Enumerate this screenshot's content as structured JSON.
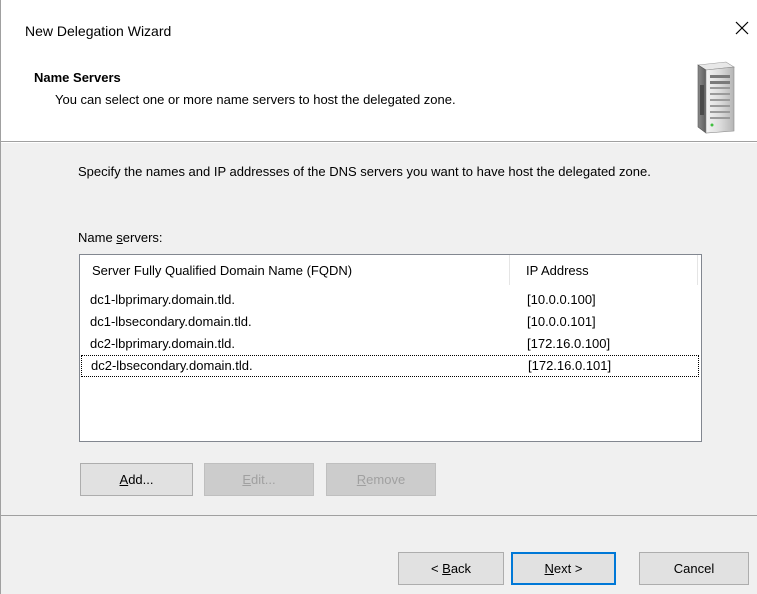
{
  "window": {
    "title": "New Delegation Wizard",
    "close_glyph": "✕"
  },
  "header": {
    "title": "Name Servers",
    "subtitle": "You can select one or more name servers to host the delegated zone.",
    "icon": "server-icon"
  },
  "body": {
    "instruction": "Specify the names and IP addresses of the DNS servers you want to have host the delegated zone.",
    "ns_label_prefix": "Name ",
    "ns_label_accel": "s",
    "ns_label_suffix": "ervers:"
  },
  "list": {
    "columns": [
      "Server Fully Qualified Domain Name (FQDN)",
      "IP Address"
    ],
    "rows": [
      {
        "fqdn": "dc1-lbprimary.domain.tld.",
        "ip": "[10.0.0.100]"
      },
      {
        "fqdn": "dc1-lbsecondary.domain.tld.",
        "ip": "[10.0.0.101]"
      },
      {
        "fqdn": "dc2-lbprimary.domain.tld.",
        "ip": "[172.16.0.100]"
      },
      {
        "fqdn": "dc2-lbsecondary.domain.tld.",
        "ip": "[172.16.0.101]"
      }
    ]
  },
  "buttons": {
    "add_accel": "A",
    "add_rest": "dd...",
    "edit_accel": "E",
    "edit_rest": "dit...",
    "remove_accel": "R",
    "remove_rest": "emove",
    "back_prefix": "< ",
    "back_accel": "B",
    "back_rest": "ack",
    "next_accel": "N",
    "next_rest": "ext >",
    "cancel": "Cancel"
  },
  "colors": {
    "accent": "#0078d7",
    "dialog_bg": "#f0f0f0",
    "separator": "#a0a0a0"
  }
}
